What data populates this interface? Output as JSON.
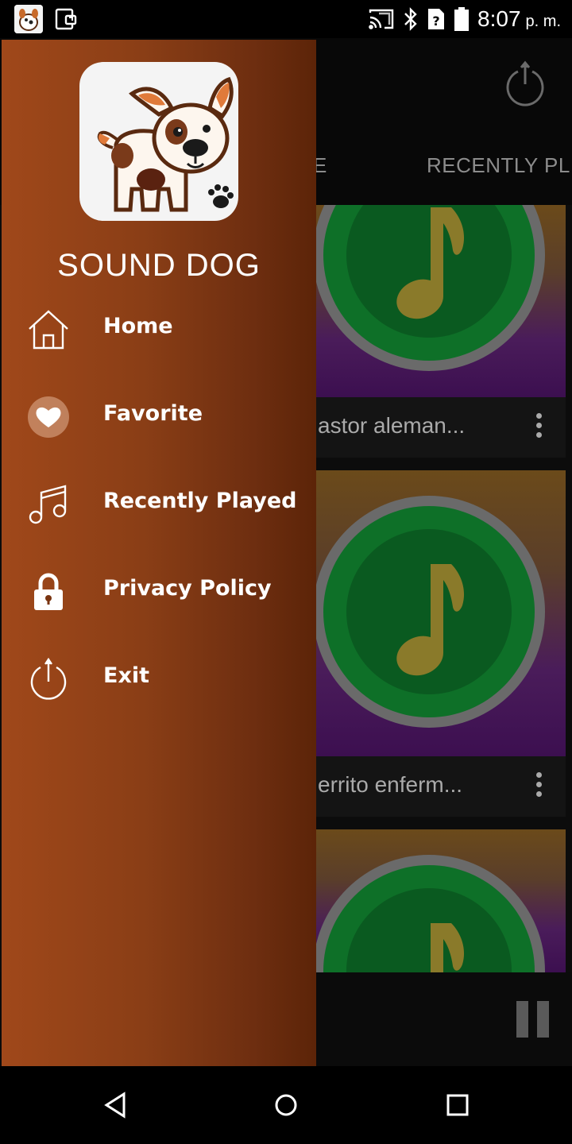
{
  "status_bar": {
    "time": "8:07",
    "ampm": "p. m.",
    "icons": [
      "app-notification-icon",
      "cast-device-icon",
      "screen-cast-icon",
      "bluetooth-icon",
      "no-sim-icon",
      "battery-icon"
    ]
  },
  "drawer": {
    "app_name": "SOUND DOG",
    "menu": [
      {
        "label": "Home",
        "icon": "home-icon"
      },
      {
        "label": "Favorite",
        "icon": "heart-icon"
      },
      {
        "label": "Recently Played",
        "icon": "music-notes-icon"
      },
      {
        "label": "Privacy Policy",
        "icon": "lock-icon"
      },
      {
        "label": "Exit",
        "icon": "power-icon"
      }
    ]
  },
  "main": {
    "tabs": [
      {
        "label": "E"
      },
      {
        "label": "RECENTLY PL"
      }
    ],
    "cards": [
      {
        "title": "astor aleman..."
      },
      {
        "title": "errito enferm..."
      },
      {
        "title": ""
      }
    ]
  },
  "colors": {
    "drawer_start": "#a0481a",
    "drawer_end": "#5c2408",
    "card_green": "#0f7a2a",
    "note_gold": "#b79a2a"
  }
}
